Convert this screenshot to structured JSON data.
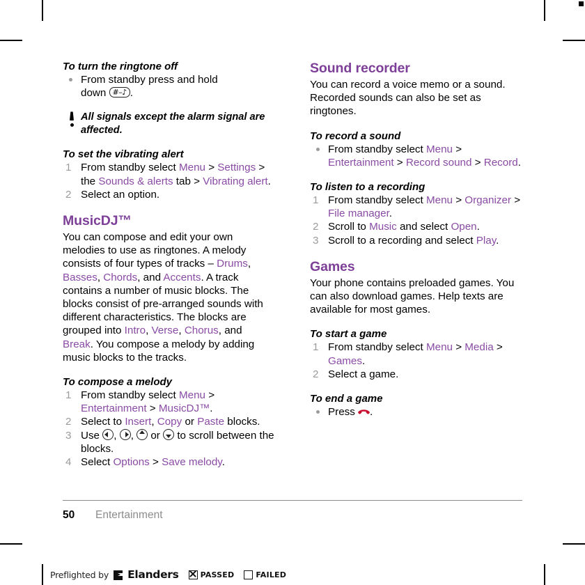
{
  "crop_marks": {
    "registration_square": "black-square"
  },
  "left_column": {
    "proc_ringtone_off": {
      "heading": "To turn the ringtone off",
      "bullet_text_a": "From standby press and hold",
      "bullet_text_b": "down",
      "key_glyph": "#",
      "bullet_text_c": "."
    },
    "note": {
      "icon": "exclamation-icon",
      "text": "All signals except the alarm signal are affected."
    },
    "proc_vibrating_alert": {
      "heading": "To set the vibrating alert",
      "steps": [
        {
          "num": "1",
          "parts": [
            {
              "t": "From standby select ",
              "k": "plain"
            },
            {
              "t": "Menu",
              "k": "link"
            },
            {
              "t": " > ",
              "k": "plain"
            },
            {
              "t": "Settings",
              "k": "link"
            },
            {
              "t": " > the ",
              "k": "plain"
            },
            {
              "t": "Sounds & alerts",
              "k": "link"
            },
            {
              "t": " tab > ",
              "k": "plain"
            },
            {
              "t": "Vibrating alert",
              "k": "link"
            },
            {
              "t": ".",
              "k": "plain"
            }
          ]
        },
        {
          "num": "2",
          "parts": [
            {
              "t": "Select an option.",
              "k": "plain"
            }
          ]
        }
      ]
    },
    "musicdj": {
      "title": "MusicDJ™",
      "body": [
        {
          "t": "You can compose and edit your own melodies to use as ringtones. A melody consists of four types of tracks – ",
          "k": "plain"
        },
        {
          "t": "Drums",
          "k": "link"
        },
        {
          "t": ", ",
          "k": "plain"
        },
        {
          "t": "Basses",
          "k": "link"
        },
        {
          "t": ", ",
          "k": "plain"
        },
        {
          "t": "Chords",
          "k": "link"
        },
        {
          "t": ", and ",
          "k": "plain"
        },
        {
          "t": "Accents",
          "k": "link"
        },
        {
          "t": ". A track contains a number of music blocks. The blocks consist of pre-arranged sounds with different characteristics. The blocks are grouped into ",
          "k": "plain"
        },
        {
          "t": "Intro",
          "k": "link"
        },
        {
          "t": ", ",
          "k": "plain"
        },
        {
          "t": "Verse",
          "k": "link"
        },
        {
          "t": ", ",
          "k": "plain"
        },
        {
          "t": "Chorus",
          "k": "link"
        },
        {
          "t": ", and ",
          "k": "plain"
        },
        {
          "t": "Break",
          "k": "link"
        },
        {
          "t": ". You compose a melody by adding music blocks to the tracks.",
          "k": "plain"
        }
      ]
    },
    "proc_compose_melody": {
      "heading": "To compose a melody",
      "step1": {
        "num": "1",
        "parts": [
          {
            "t": "From standby select ",
            "k": "plain"
          },
          {
            "t": "Menu",
            "k": "link"
          },
          {
            "t": " > ",
            "k": "plain"
          },
          {
            "t": "Entertainment",
            "k": "link"
          },
          {
            "t": " > ",
            "k": "plain"
          },
          {
            "t": "MusicDJ™",
            "k": "link"
          },
          {
            "t": ".",
            "k": "plain"
          }
        ]
      },
      "step2": {
        "num": "2",
        "parts": [
          {
            "t": "Select to ",
            "k": "plain"
          },
          {
            "t": "Insert",
            "k": "link"
          },
          {
            "t": ", ",
            "k": "plain"
          },
          {
            "t": "Copy",
            "k": "link"
          },
          {
            "t": " or ",
            "k": "plain"
          },
          {
            "t": "Paste",
            "k": "link"
          },
          {
            "t": " blocks.",
            "k": "plain"
          }
        ]
      },
      "step3": {
        "num": "3",
        "pre": "Use ",
        "sep1": ", ",
        "sep2": ", ",
        "sep3": " or ",
        "post": " to scroll between the blocks.",
        "keys": [
          "nav-left-key-icon",
          "nav-right-key-icon",
          "nav-up-key-icon",
          "nav-down-key-icon"
        ]
      },
      "step4": {
        "num": "4",
        "parts": [
          {
            "t": "Select ",
            "k": "plain"
          },
          {
            "t": "Options",
            "k": "link"
          },
          {
            "t": " > ",
            "k": "plain"
          },
          {
            "t": "Save melody",
            "k": "link"
          },
          {
            "t": ".",
            "k": "plain"
          }
        ]
      }
    }
  },
  "right_column": {
    "sound_recorder": {
      "title": "Sound recorder",
      "body": "You can record a voice memo or a sound. Recorded sounds can also be set as ringtones."
    },
    "proc_record_sound": {
      "heading": "To record a sound",
      "bullet_parts": [
        {
          "t": "From standby select ",
          "k": "plain"
        },
        {
          "t": "Menu",
          "k": "link"
        },
        {
          "t": " > ",
          "k": "plain"
        },
        {
          "t": "Entertainment",
          "k": "link"
        },
        {
          "t": " > ",
          "k": "plain"
        },
        {
          "t": "Record sound",
          "k": "link"
        },
        {
          "t": " > ",
          "k": "plain"
        },
        {
          "t": "Record",
          "k": "link"
        },
        {
          "t": ".",
          "k": "plain"
        }
      ]
    },
    "proc_listen_recording": {
      "heading": "To listen to a recording",
      "steps": [
        {
          "num": "1",
          "parts": [
            {
              "t": "From standby select ",
              "k": "plain"
            },
            {
              "t": "Menu",
              "k": "link"
            },
            {
              "t": " > ",
              "k": "plain"
            },
            {
              "t": "Organizer",
              "k": "link"
            },
            {
              "t": " > ",
              "k": "plain"
            },
            {
              "t": "File manager",
              "k": "link"
            },
            {
              "t": ".",
              "k": "plain"
            }
          ]
        },
        {
          "num": "2",
          "parts": [
            {
              "t": "Scroll to ",
              "k": "plain"
            },
            {
              "t": "Music",
              "k": "link"
            },
            {
              "t": " and select ",
              "k": "plain"
            },
            {
              "t": "Open",
              "k": "link"
            },
            {
              "t": ".",
              "k": "plain"
            }
          ]
        },
        {
          "num": "3",
          "parts": [
            {
              "t": "Scroll to a recording and select ",
              "k": "plain"
            },
            {
              "t": "Play",
              "k": "link"
            },
            {
              "t": ".",
              "k": "plain"
            }
          ]
        }
      ]
    },
    "games": {
      "title": "Games",
      "body": "Your phone contains preloaded games. You can also download games. Help texts are available for most games."
    },
    "proc_start_game": {
      "heading": "To start a game",
      "steps": [
        {
          "num": "1",
          "parts": [
            {
              "t": "From standby select ",
              "k": "plain"
            },
            {
              "t": "Menu",
              "k": "link"
            },
            {
              "t": " > ",
              "k": "plain"
            },
            {
              "t": "Media",
              "k": "link"
            },
            {
              "t": " > ",
              "k": "plain"
            },
            {
              "t": "Games",
              "k": "link"
            },
            {
              "t": ".",
              "k": "plain"
            }
          ]
        },
        {
          "num": "2",
          "parts": [
            {
              "t": "Select a game.",
              "k": "plain"
            }
          ]
        }
      ]
    },
    "proc_end_game": {
      "heading": "To end a game",
      "bullet_pre": "Press ",
      "icon": "end-call-icon",
      "bullet_post": "."
    }
  },
  "footer": {
    "page_number": "50",
    "chapter": "Entertainment"
  },
  "preflight_bar": {
    "label": "Preflighted by",
    "logo": "elanders-logo-icon",
    "brand": "Elanders",
    "passed_label": "PASSED",
    "failed_label": "FAILED",
    "passed_checked": true,
    "failed_checked": false
  },
  "colors": {
    "accent_purple": "#7d3f98",
    "link_purple": "#8a4ba5",
    "step_number_grey": "#9b9b9b",
    "folio_grey": "#8c8c8c",
    "end_call_red": "#c8102e"
  }
}
